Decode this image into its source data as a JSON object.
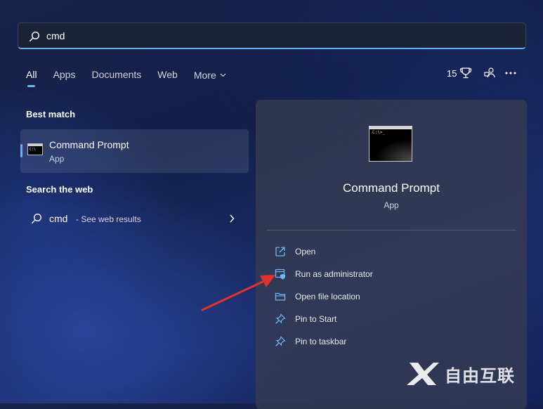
{
  "search": {
    "value": "cmd",
    "icon": "search-icon"
  },
  "tabs": [
    {
      "label": "All",
      "active": true
    },
    {
      "label": "Apps"
    },
    {
      "label": "Documents"
    },
    {
      "label": "Web"
    },
    {
      "label": "More"
    }
  ],
  "header": {
    "points": "15",
    "points_icon": "trophy-icon",
    "account_icon": "account-network-icon",
    "more_icon": "ellipsis-icon"
  },
  "best_match": {
    "section_title": "Best match",
    "item": {
      "title": "Command Prompt",
      "subtitle": "App",
      "icon": "command-prompt-icon"
    }
  },
  "search_web": {
    "section_title": "Search the web",
    "query": "cmd",
    "suffix": " - See web results"
  },
  "preview": {
    "title": "Command Prompt",
    "subtitle": "App",
    "actions": [
      {
        "label": "Open",
        "icon": "open-external-icon"
      },
      {
        "label": "Run as administrator",
        "icon": "admin-shield-icon"
      },
      {
        "label": "Open file location",
        "icon": "folder-icon"
      },
      {
        "label": "Pin to Start",
        "icon": "pin-icon"
      },
      {
        "label": "Pin to taskbar",
        "icon": "pin-icon"
      }
    ]
  },
  "colors": {
    "accent": "#60b4f4",
    "annotation_arrow": "#e0322e"
  },
  "watermark": {
    "text": "自由互联"
  }
}
